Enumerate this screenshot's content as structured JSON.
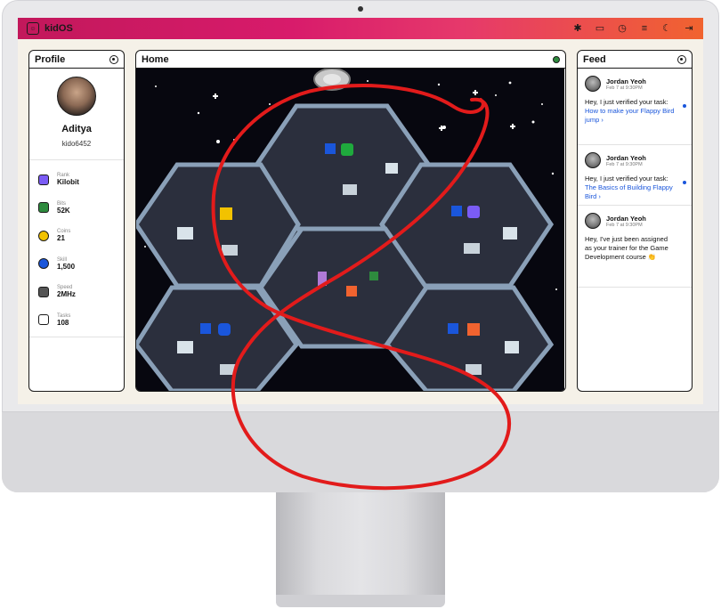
{
  "app": {
    "title": "kidOS",
    "logo_glyph": "☺"
  },
  "topbar": {
    "icons": [
      {
        "name": "bug-icon",
        "glyph": "✱"
      },
      {
        "name": "video-icon",
        "glyph": "▭"
      },
      {
        "name": "clock-icon",
        "glyph": "◷"
      },
      {
        "name": "sliders-icon",
        "glyph": "≡"
      },
      {
        "name": "moon-icon",
        "glyph": "☾"
      },
      {
        "name": "logout-icon",
        "glyph": "⇥"
      }
    ]
  },
  "profile": {
    "title": "Profile",
    "name": "Aditya",
    "handle": "kido6452",
    "stats": [
      {
        "label": "Rank",
        "value": "Kilobit",
        "icon": "rank-icon",
        "color": "#7b5cf5"
      },
      {
        "label": "Bits",
        "value": "52K",
        "icon": "bits-icon",
        "color": "#2e8b3e"
      },
      {
        "label": "Coins",
        "value": "21",
        "icon": "coin-icon",
        "color": "#f2c200"
      },
      {
        "label": "Skill",
        "value": "1,500",
        "icon": "skill-icon",
        "color": "#1a56db"
      },
      {
        "label": "Speed",
        "value": "2MHz",
        "icon": "chip-icon",
        "color": "#555555"
      },
      {
        "label": "Tasks",
        "value": "108",
        "icon": "clipboard-icon",
        "color": "#333333"
      }
    ]
  },
  "home": {
    "title": "Home",
    "status_color": "#2e8b3e"
  },
  "feed": {
    "title": "Feed",
    "items": [
      {
        "name": "Jordan Yeoh",
        "time": "Feb 7 at 9:30PM",
        "text": "Hey, I just verified your task: ",
        "link": "How to make your Flappy Bird jump",
        "unread": true
      },
      {
        "name": "Jordan Yeoh",
        "time": "Feb 7 at 9:30PM",
        "text": "Hey, I just verified your task: ",
        "link": "The Basics of Building Flappy Bird",
        "unread": true
      },
      {
        "name": "Jordan Yeoh",
        "time": "Feb 7 at 9:30PM",
        "text": "Hey, I've just been assigned as your trainer for the Game Development course 👏",
        "link": "",
        "unread": false
      }
    ]
  },
  "colors": {
    "accent": "#1a56db",
    "annotation": "#e21b1b",
    "brand_gradient_start": "#c2185b",
    "brand_gradient_end": "#f1632f"
  }
}
